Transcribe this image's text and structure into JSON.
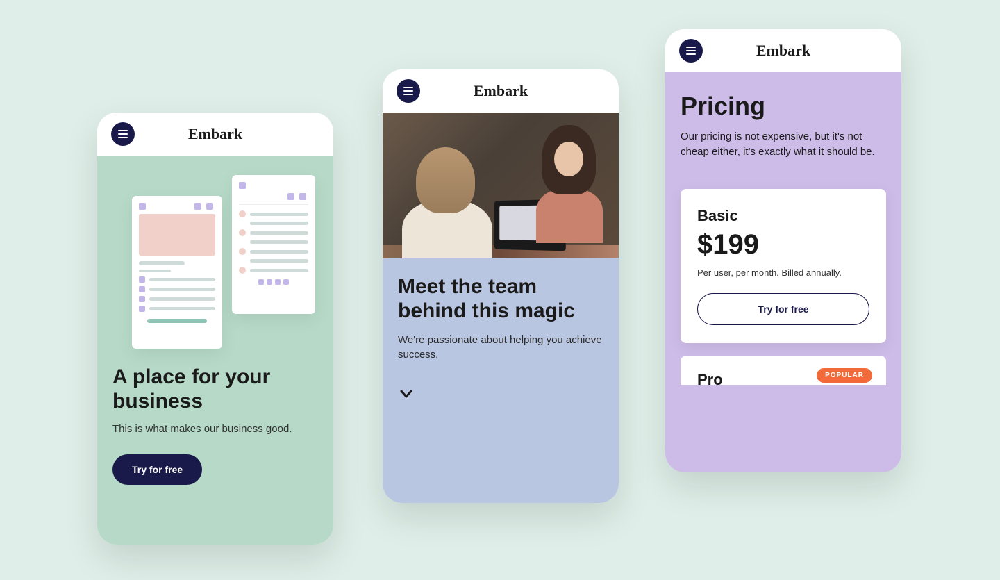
{
  "brand": "Embark",
  "screen1": {
    "title": "A place for your business",
    "subtitle": "This is what makes our business good.",
    "cta": "Try for free"
  },
  "screen2": {
    "title": "Meet the team behind this magic",
    "subtitle": "We're passionate about helping you achieve success."
  },
  "screen3": {
    "title": "Pricing",
    "subtitle": "Our pricing is not expensive, but it's not cheap either, it's exactly what it should be.",
    "plan1": {
      "name": "Basic",
      "price": "$199",
      "terms": "Per user, per month. Billed annually.",
      "cta": "Try for free"
    },
    "plan2": {
      "name": "Pro",
      "badge": "POPULAR"
    }
  }
}
